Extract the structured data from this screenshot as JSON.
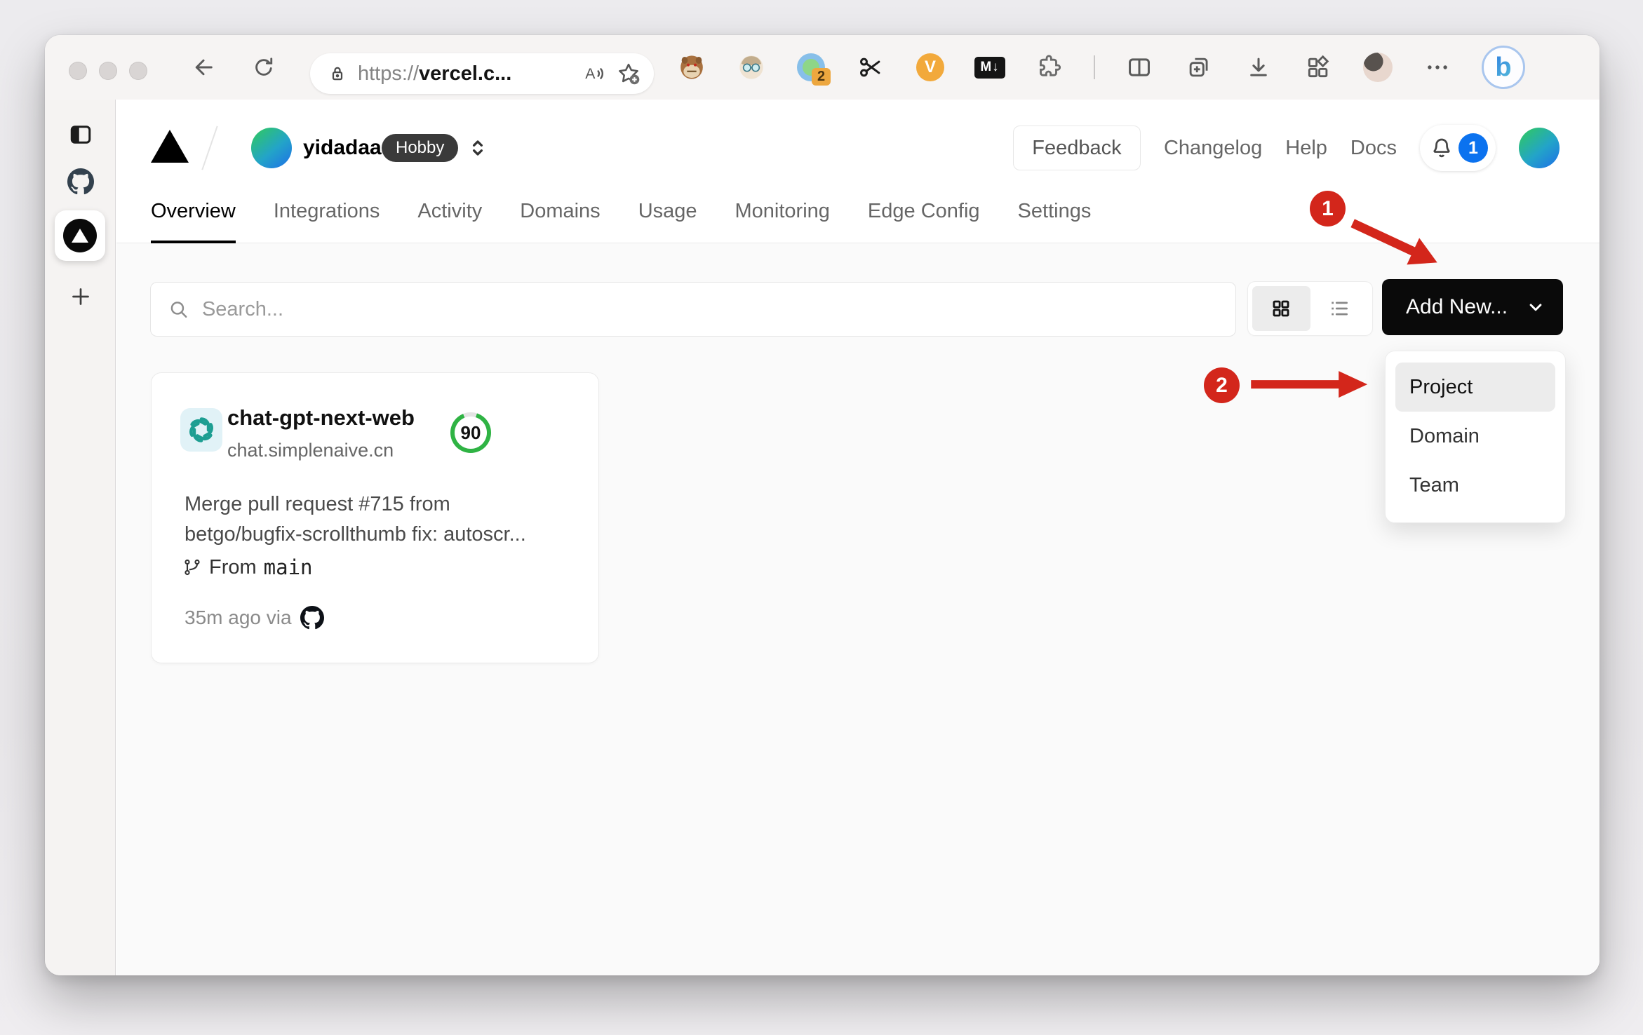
{
  "browser": {
    "url": {
      "scheme": "https://",
      "host": "vercel.c..."
    },
    "extensions": {
      "badge_count": "2",
      "markdown_label": "M↓",
      "v_label": "V",
      "bing_label": "b"
    }
  },
  "sidebar": {
    "active_tab": "vercel"
  },
  "header": {
    "team_name": "yidadaa",
    "plan_badge": "Hobby",
    "feedback_label": "Feedback",
    "changelog_label": "Changelog",
    "help_label": "Help",
    "docs_label": "Docs",
    "notification_count": "1"
  },
  "tabs": [
    {
      "label": "Overview",
      "active": true
    },
    {
      "label": "Integrations"
    },
    {
      "label": "Activity"
    },
    {
      "label": "Domains"
    },
    {
      "label": "Usage"
    },
    {
      "label": "Monitoring"
    },
    {
      "label": "Edge Config"
    },
    {
      "label": "Settings"
    }
  ],
  "toolbar": {
    "search_placeholder": "Search...",
    "add_new_label": "Add New..."
  },
  "dropdown": {
    "items": [
      {
        "label": "Project",
        "highlighted": true
      },
      {
        "label": "Domain"
      },
      {
        "label": "Team"
      }
    ]
  },
  "project_card": {
    "name": "chat-gpt-next-web",
    "domain": "chat.simplenaive.cn",
    "score": "90",
    "commit_line1": "Merge pull request #715 from",
    "commit_line2": "betgo/bugfix-scrollthumb fix: autoscr...",
    "branch_prefix": "From",
    "branch_name": "main",
    "updated": "35m ago via"
  },
  "annotations": {
    "step1": "1",
    "step2": "2"
  },
  "colors": {
    "annotation_red": "#d3261b",
    "notification_blue": "#0b72ef",
    "score_green": "#2fb344",
    "button_black": "#0a0a0a"
  }
}
